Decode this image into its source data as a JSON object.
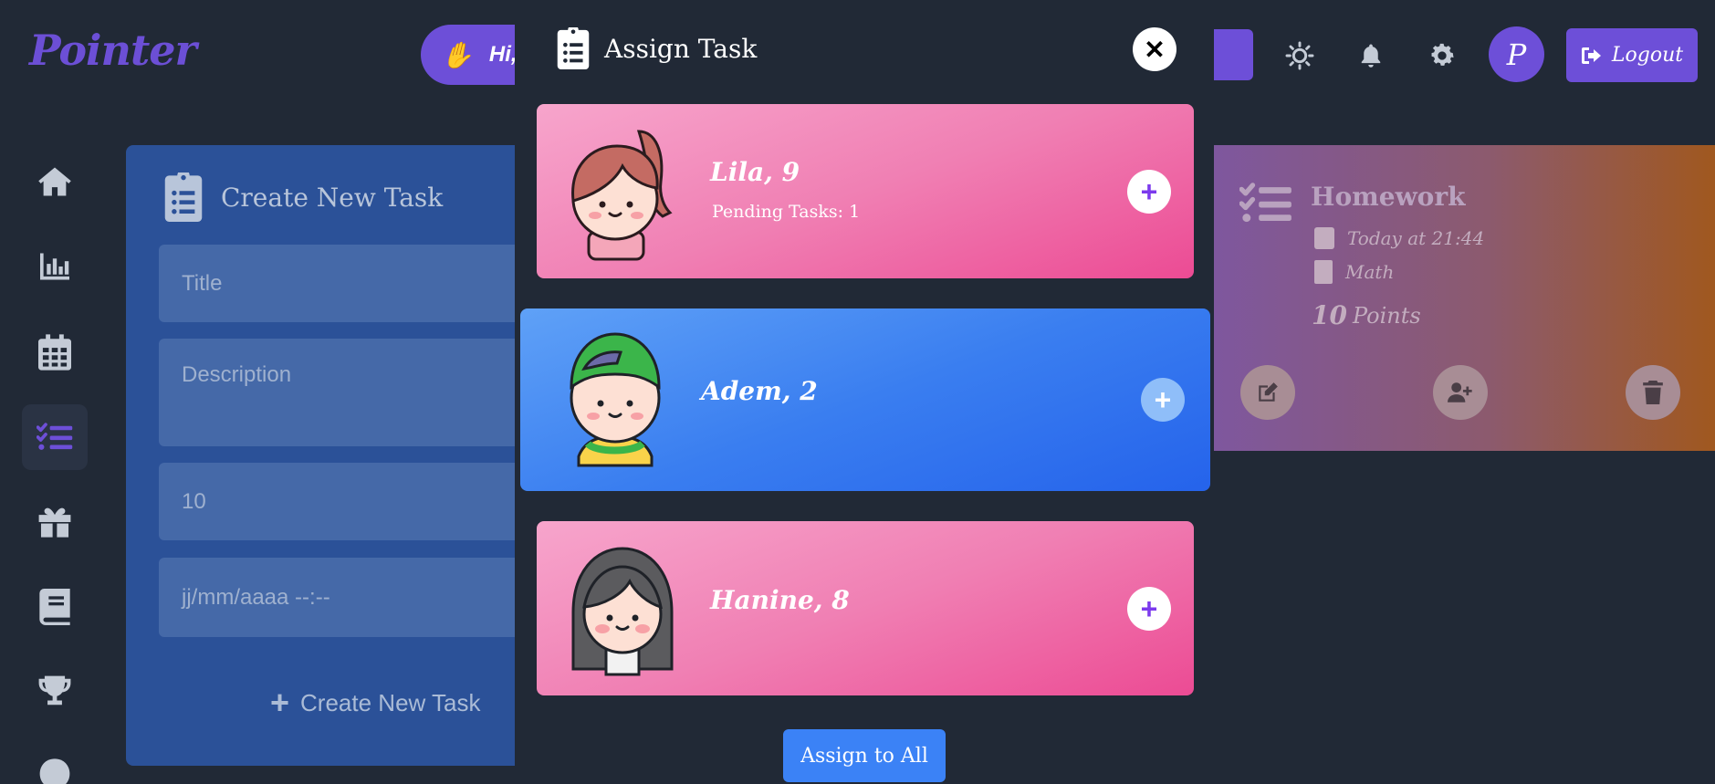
{
  "app": {
    "logo": "Pointer"
  },
  "header": {
    "greeting": "Hi, P",
    "avatar_letter": "P",
    "logout_label": "Logout"
  },
  "sidebar": {
    "items": [
      {
        "icon": "home-icon"
      },
      {
        "icon": "chart-icon"
      },
      {
        "icon": "calendar-icon"
      },
      {
        "icon": "tasks-icon",
        "active": true
      },
      {
        "icon": "gift-icon"
      },
      {
        "icon": "book-icon"
      },
      {
        "icon": "trophy-icon"
      },
      {
        "icon": "balloon-icon"
      }
    ]
  },
  "create_task": {
    "title": "Create New Task",
    "title_placeholder": "Title",
    "description_placeholder": "Description",
    "points_value": "10",
    "date_placeholder": "jj/mm/aaaa --:--",
    "submit_label": "Create New Task"
  },
  "task_card": {
    "title": "Homework",
    "due": "Today at 21:44",
    "subject": "Math",
    "points_number": "10",
    "points_label": "Points"
  },
  "modal": {
    "title": "Assign Task",
    "children": [
      {
        "name": "Lila, 9",
        "pending": "Pending Tasks: 1",
        "color": "pink"
      },
      {
        "name": "Adem, 2",
        "pending": "",
        "color": "blue"
      },
      {
        "name": "Hanine, 8",
        "pending": "",
        "color": "pink"
      }
    ],
    "assign_all_label": "Assign to All"
  },
  "colors": {
    "accent": "#6d4fd8",
    "pink": "#ec4b94",
    "blue": "#2563eb",
    "assign_button": "#3b82f6"
  }
}
